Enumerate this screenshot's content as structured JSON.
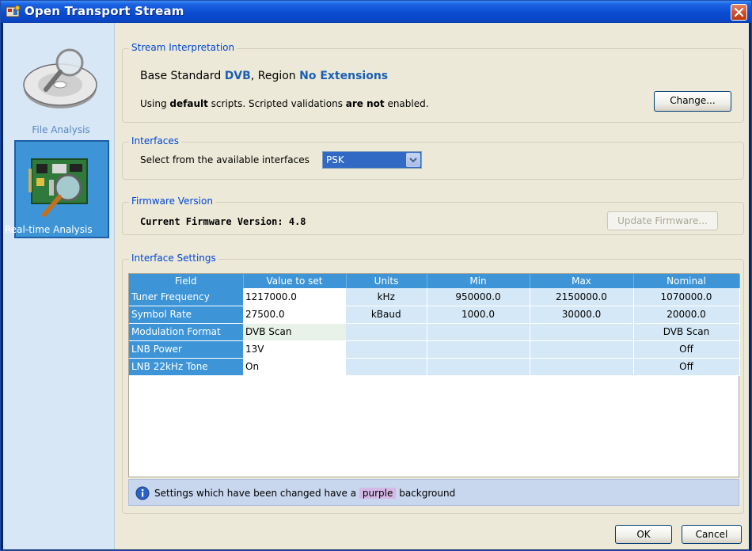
{
  "window": {
    "title": "Open Transport Stream"
  },
  "sidebar": {
    "items": [
      {
        "label": "File Analysis",
        "icon": "magnifier-disc-icon"
      },
      {
        "label": "Real-time Analysis",
        "icon": "circuit-board-magnifier-icon",
        "selected": true
      }
    ]
  },
  "stream_interpretation": {
    "title": "Stream Interpretation",
    "base_prefix": "Base Standard ",
    "base_value": "DVB",
    "region_prefix": ", Region ",
    "region_value": "No Extensions",
    "scripts_pre": "Using ",
    "scripts_bold1": "default",
    "scripts_mid": " scripts. Scripted validations ",
    "scripts_bold2": "are not",
    "scripts_post": " enabled.",
    "change_label": "Change..."
  },
  "interfaces": {
    "title": "Interfaces",
    "label": "Select from the available interfaces",
    "selected": "PSK"
  },
  "firmware": {
    "title": "Firmware Version",
    "current": "Current Firmware Version: 4.8",
    "update_label": "Update Firmware..."
  },
  "interface_settings": {
    "title": "Interface Settings",
    "columns": [
      "Field",
      "Value to set",
      "Units",
      "Min",
      "Max",
      "Nominal"
    ],
    "rows": [
      {
        "field": "Tuner Frequency",
        "value": "1217000.0",
        "units": "kHz",
        "min": "950000.0",
        "max": "2150000.0",
        "nominal": "1070000.0"
      },
      {
        "field": "Symbol Rate",
        "value": "27500.0",
        "units": "kBaud",
        "min": "1000.0",
        "max": "30000.0",
        "nominal": "20000.0"
      },
      {
        "field": "Modulation Format",
        "value": "DVB Scan",
        "units": "",
        "min": "",
        "max": "",
        "nominal": "DVB Scan"
      },
      {
        "field": "LNB Power",
        "value": "13V",
        "units": "",
        "min": "",
        "max": "",
        "nominal": "Off"
      },
      {
        "field": "LNB 22kHz Tone",
        "value": "On",
        "units": "",
        "min": "",
        "max": "",
        "nominal": "Off"
      }
    ],
    "info_pre": "Settings which have been changed have a ",
    "info_highlight": "purple",
    "info_post": " background"
  },
  "footer": {
    "ok_label": "OK",
    "cancel_label": "Cancel"
  },
  "colors": {
    "title_bar": "#0a4cd2",
    "header_blue": "#3d95d8",
    "cell_light_blue": "#d5e8f7",
    "changed_purple": "#d4b8e6",
    "link_blue": "#1c5fb2"
  }
}
